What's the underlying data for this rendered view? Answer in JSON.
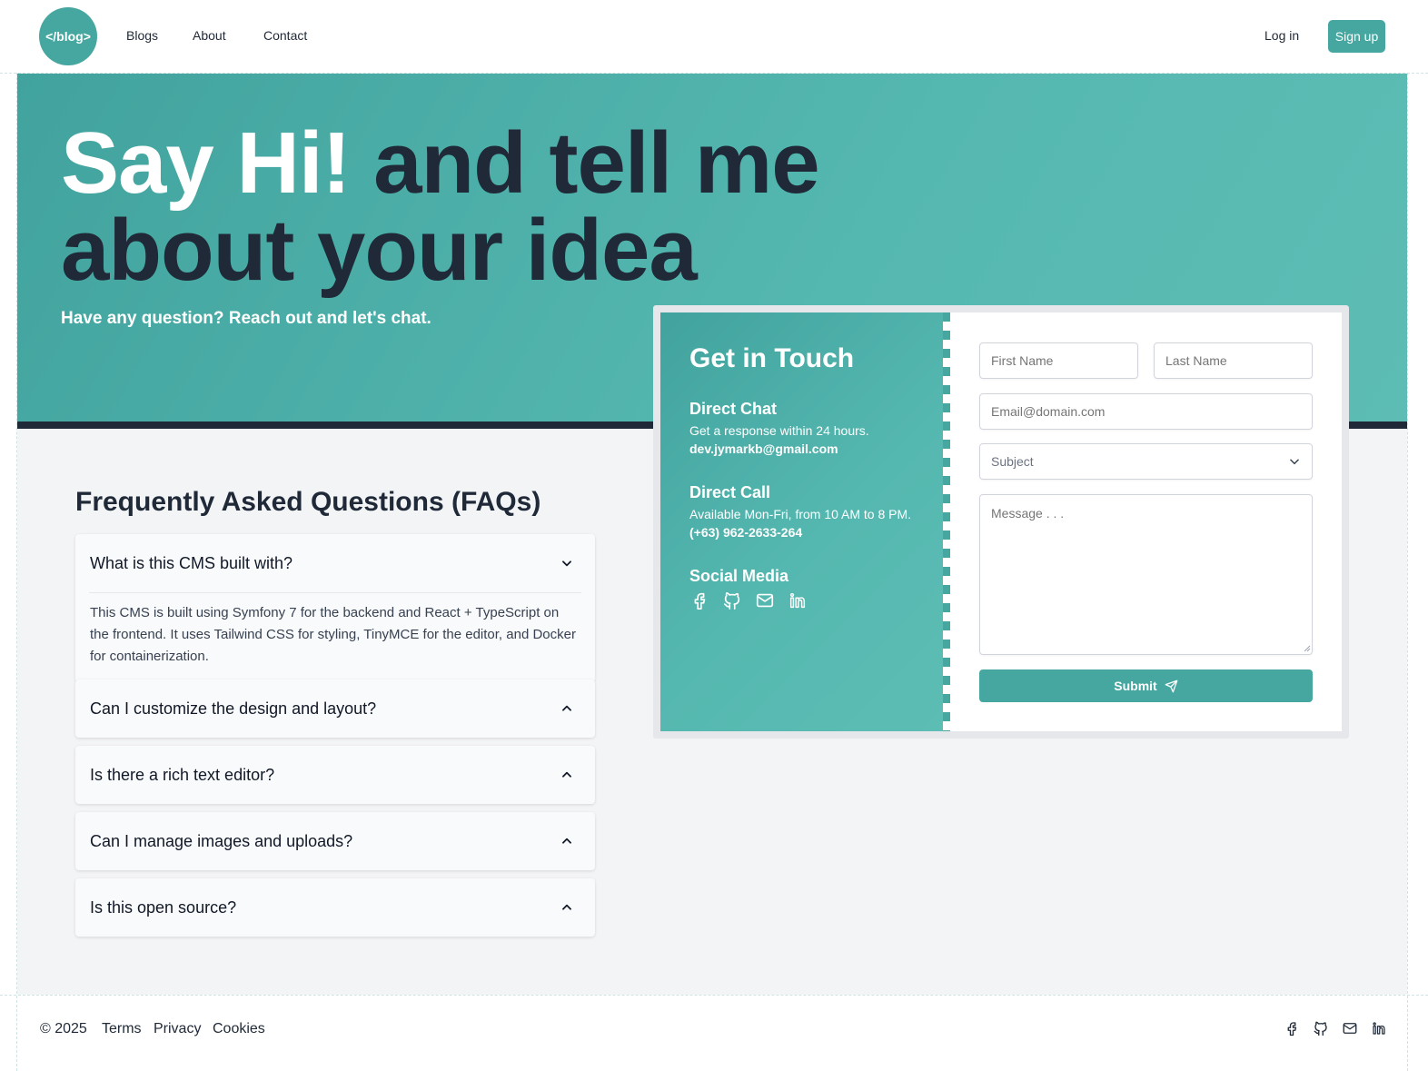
{
  "header": {
    "logo_text": "</blog>",
    "nav": [
      "Blogs",
      "About",
      "Contact"
    ],
    "login_label": "Log in",
    "signup_label": "Sign up"
  },
  "hero": {
    "title_highlight": "Say Hi!",
    "title_rest_1": "and tell me",
    "title_rest_2": "about your idea",
    "subtitle": "Have any question? Reach out and let's chat."
  },
  "faq": {
    "title": "Frequently Asked Questions (FAQs)",
    "items": [
      {
        "question": "What is this CMS built with?",
        "answer": "This CMS is built using Symfony 7 for the backend and React + TypeScript on the frontend. It uses Tailwind CSS for styling, TinyMCE for the editor, and Docker for containerization.",
        "expanded": true
      },
      {
        "question": "Can I customize the design and layout?",
        "expanded": false
      },
      {
        "question": "Is there a rich text editor?",
        "expanded": false
      },
      {
        "question": "Can I manage images and uploads?",
        "expanded": false
      },
      {
        "question": "Is this open source?",
        "expanded": false
      }
    ]
  },
  "contact": {
    "title": "Get in Touch",
    "direct_chat": {
      "heading": "Direct Chat",
      "text": "Get a response within 24 hours.",
      "value": "dev.jymarkb@gmail.com"
    },
    "direct_call": {
      "heading": "Direct Call",
      "text": "Available Mon-Fri, from 10 AM to 8 PM.",
      "value": "(+63) 962-2633-264"
    },
    "social_heading": "Social Media",
    "social_icons": [
      "facebook-icon",
      "github-icon",
      "mail-icon",
      "linkedin-icon"
    ],
    "form": {
      "first_name_placeholder": "First Name",
      "last_name_placeholder": "Last Name",
      "email_placeholder": "Email@domain.com",
      "subject_selected": "Subject",
      "message_placeholder": "Message . . .",
      "submit_label": "Submit"
    }
  },
  "footer": {
    "copyright": "© 2025",
    "links": [
      "Terms",
      "Privacy",
      "Cookies"
    ],
    "social_icons": [
      "facebook-icon",
      "github-icon",
      "mail-icon",
      "linkedin-icon"
    ]
  },
  "colors": {
    "accent": "#45a7a0",
    "dark": "#1f2937",
    "background": "#f3f4f6"
  }
}
